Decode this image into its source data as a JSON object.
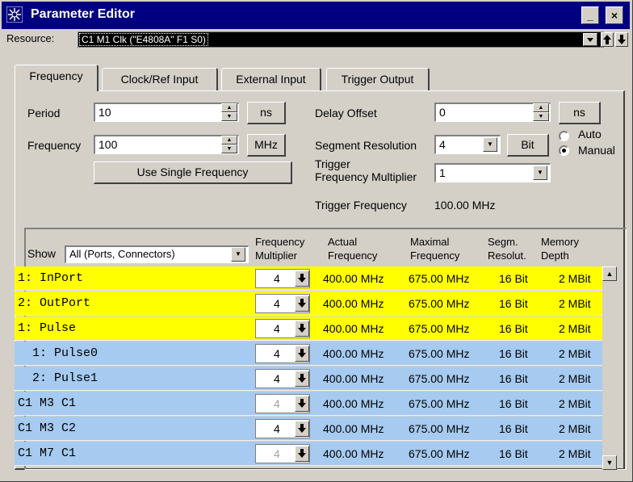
{
  "window": {
    "title": "Parameter Editor",
    "minimize": "_",
    "close": "×"
  },
  "resource": {
    "label": "Resource:",
    "value": "C1 M1 Clk (\"E4808A\" F1 S0)"
  },
  "tabs": [
    {
      "label": "Frequency",
      "active": true
    },
    {
      "label": "Clock/Ref Input",
      "active": false
    },
    {
      "label": "External Input",
      "active": false
    },
    {
      "label": "Trigger Output",
      "active": false
    }
  ],
  "left": {
    "period_label": "Period",
    "period_value": "10",
    "period_unit": "ns",
    "frequency_label": "Frequency",
    "frequency_value": "100",
    "frequency_unit": "MHz",
    "use_single_label": "Use Single Frequency"
  },
  "right": {
    "delay_label": "Delay Offset",
    "delay_value": "0",
    "delay_unit": "ns",
    "segment_label": "Segment Resolution",
    "segment_value": "4",
    "segment_unit": "Bit",
    "auto_label": "Auto",
    "manual_label": "Manual",
    "selected_mode": "Manual",
    "trigmult_label_1": "Trigger",
    "trigmult_label_2": "Frequency Multiplier",
    "trigmult_value": "1",
    "trigfreq_label": "Trigger Frequency",
    "trigfreq_value": "100.00 MHz"
  },
  "table": {
    "show_label": "Show",
    "show_value": "All (Ports, Connectors)",
    "headers": {
      "freq_mult_1": "Frequency",
      "freq_mult_2": "Multiplier",
      "actual_1": "Actual",
      "actual_2": "Frequency",
      "max_1": "Maximal",
      "max_2": "Frequency",
      "segm_1": "Segm.",
      "segm_2": "Resolut.",
      "mem_1": "Memory",
      "mem_2": "Depth"
    },
    "rows": [
      {
        "name": "1: InPort",
        "mult": "4",
        "actual": "400.00 MHz",
        "max": "675.00 MHz",
        "segm": "16 Bit",
        "mem": "2 MBit",
        "color": "#ffff00",
        "dim": false
      },
      {
        "name": "2: OutPort",
        "mult": "4",
        "actual": "400.00 MHz",
        "max": "675.00 MHz",
        "segm": "16 Bit",
        "mem": "2 MBit",
        "color": "#ffff00",
        "dim": false
      },
      {
        "name": "1: Pulse",
        "mult": "4",
        "actual": "400.00 MHz",
        "max": "675.00 MHz",
        "segm": "16 Bit",
        "mem": "2 MBit",
        "color": "#ffff00",
        "dim": false
      },
      {
        "name": "  1: Pulse0",
        "mult": "4",
        "actual": "400.00 MHz",
        "max": "675.00 MHz",
        "segm": "16 Bit",
        "mem": "2 MBit",
        "color": "#a6caf0",
        "dim": false
      },
      {
        "name": "  2: Pulse1",
        "mult": "4",
        "actual": "400.00 MHz",
        "max": "675.00 MHz",
        "segm": "16 Bit",
        "mem": "2 MBit",
        "color": "#a6caf0",
        "dim": false
      },
      {
        "name": "C1 M3 C1",
        "mult": "4",
        "actual": "400.00 MHz",
        "max": "675.00 MHz",
        "segm": "16 Bit",
        "mem": "2 MBit",
        "color": "#a6caf0",
        "dim": true
      },
      {
        "name": "C1 M3 C2",
        "mult": "4",
        "actual": "400.00 MHz",
        "max": "675.00 MHz",
        "segm": "16 Bit",
        "mem": "2 MBit",
        "color": "#a6caf0",
        "dim": false
      },
      {
        "name": "C1 M7 C1",
        "mult": "4",
        "actual": "400.00 MHz",
        "max": "675.00 MHz",
        "segm": "16 Bit",
        "mem": "2 MBit",
        "color": "#a6caf0",
        "dim": true
      }
    ]
  }
}
